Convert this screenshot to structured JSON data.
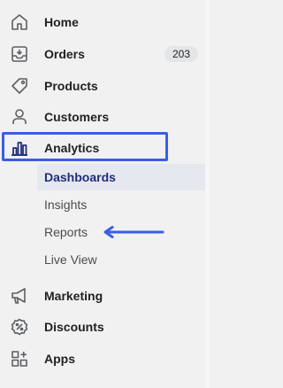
{
  "nav": {
    "items": [
      {
        "label": "Home",
        "icon": "home-icon"
      },
      {
        "label": "Orders",
        "icon": "orders-icon",
        "badge": "203"
      },
      {
        "label": "Products",
        "icon": "tag-icon"
      },
      {
        "label": "Customers",
        "icon": "person-icon"
      },
      {
        "label": "Analytics",
        "icon": "bar-chart-icon"
      }
    ],
    "analytics_sub": [
      {
        "label": "Dashboards",
        "active": true
      },
      {
        "label": "Insights"
      },
      {
        "label": "Reports"
      },
      {
        "label": "Live View"
      }
    ],
    "more_items": [
      {
        "label": "Marketing",
        "icon": "megaphone-icon"
      },
      {
        "label": "Discounts",
        "icon": "discount-icon"
      },
      {
        "label": "Apps",
        "icon": "apps-icon"
      }
    ]
  },
  "colors": {
    "highlight_box": "#3a5ee6",
    "arrow": "#3a5ee6",
    "active_sub_bg": "#e6e8f0",
    "active_sub_text": "#202e78"
  }
}
